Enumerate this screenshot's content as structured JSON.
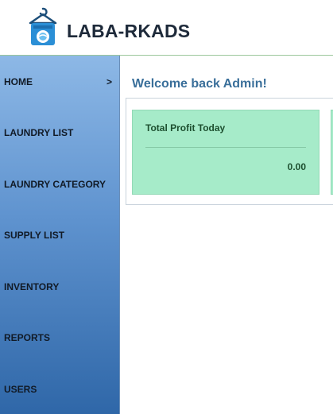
{
  "brand": {
    "name": "LABA-RKADS",
    "icon": "laundry-hanger-washer-icon"
  },
  "sidebar": {
    "items": [
      {
        "label": "HOME",
        "chevron": ">"
      },
      {
        "label": "LAUNDRY LIST"
      },
      {
        "label": "LAUNDRY CATEGORY"
      },
      {
        "label": "SUPPLY LIST"
      },
      {
        "label": "INVENTORY"
      },
      {
        "label": "REPORTS"
      },
      {
        "label": "USERS"
      }
    ]
  },
  "main": {
    "welcome": "Welcome back Admin!",
    "cards": [
      {
        "title": "Total Profit Today",
        "value": "0.00"
      }
    ]
  },
  "colors": {
    "sidebar_top": "#8db8e6",
    "sidebar_bottom": "#2f67a8",
    "card_bg": "#a6ebc9",
    "welcome_text": "#3a6f9a"
  }
}
